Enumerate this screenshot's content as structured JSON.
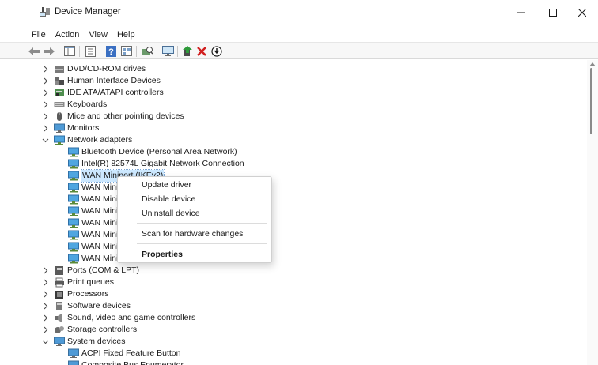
{
  "window": {
    "title": "Device Manager",
    "app_icon": "device-manager-icon",
    "controls": [
      "minimize-icon",
      "maximize-icon",
      "close-icon"
    ]
  },
  "menu": [
    "File",
    "Action",
    "View",
    "Help"
  ],
  "toolbar": {
    "buttons": [
      "back-arrow-icon",
      "forward-arrow-icon",
      "show-hide-console-tree-icon",
      "properties-sheet-icon",
      "help-icon",
      "view-icon",
      "scan-hardware-icon",
      "monitor-icon",
      "update-driver-icon",
      "uninstall-x-icon",
      "download-circle-icon"
    ]
  },
  "tree": {
    "rows": [
      {
        "label": "DVD/CD-ROM drives",
        "level": 0,
        "expanded": false,
        "icon": "dvd-drive-icon"
      },
      {
        "label": "Human Interface Devices",
        "level": 0,
        "expanded": false,
        "icon": "hid-icon"
      },
      {
        "label": "IDE ATA/ATAPI controllers",
        "level": 0,
        "expanded": false,
        "icon": "ide-controller-icon"
      },
      {
        "label": "Keyboards",
        "level": 0,
        "expanded": false,
        "icon": "keyboard-icon"
      },
      {
        "label": "Mice and other pointing devices",
        "level": 0,
        "expanded": false,
        "icon": "mouse-icon"
      },
      {
        "label": "Monitors",
        "level": 0,
        "expanded": false,
        "icon": "monitor-icon"
      },
      {
        "label": "Network adapters",
        "level": 0,
        "expanded": true,
        "icon": "network-adapter-icon"
      },
      {
        "label": "Bluetooth Device (Personal Area Network)",
        "level": 1,
        "icon": "network-adapter-icon"
      },
      {
        "label": "Intel(R) 82574L Gigabit Network Connection",
        "level": 1,
        "icon": "network-adapter-icon"
      },
      {
        "label": "WAN Miniport (IKEv2)",
        "level": 1,
        "icon": "network-adapter-icon",
        "selected": true
      },
      {
        "label": "WAN Mini",
        "level": 1,
        "icon": "network-adapter-icon"
      },
      {
        "label": "WAN Mini",
        "level": 1,
        "icon": "network-adapter-icon"
      },
      {
        "label": "WAN Mini",
        "level": 1,
        "icon": "network-adapter-icon"
      },
      {
        "label": "WAN Mini",
        "level": 1,
        "icon": "network-adapter-icon"
      },
      {
        "label": "WAN Mini",
        "level": 1,
        "icon": "network-adapter-icon"
      },
      {
        "label": "WAN Mini",
        "level": 1,
        "icon": "network-adapter-icon"
      },
      {
        "label": "WAN Mini",
        "level": 1,
        "icon": "network-adapter-icon"
      },
      {
        "label": "Ports (COM & LPT)",
        "level": 0,
        "expanded": false,
        "icon": "port-icon"
      },
      {
        "label": "Print queues",
        "level": 0,
        "expanded": false,
        "icon": "printer-icon"
      },
      {
        "label": "Processors",
        "level": 0,
        "expanded": false,
        "icon": "processor-icon"
      },
      {
        "label": "Software devices",
        "level": 0,
        "expanded": false,
        "icon": "software-device-icon"
      },
      {
        "label": "Sound, video and game controllers",
        "level": 0,
        "expanded": false,
        "icon": "sound-icon"
      },
      {
        "label": "Storage controllers",
        "level": 0,
        "expanded": false,
        "icon": "storage-controller-icon"
      },
      {
        "label": "System devices",
        "level": 0,
        "expanded": true,
        "icon": "system-device-icon"
      },
      {
        "label": "ACPI Fixed Feature Button",
        "level": 1,
        "icon": "system-device-icon"
      },
      {
        "label": "Composite Bus Enumerator",
        "level": 1,
        "icon": "system-device-icon"
      }
    ]
  },
  "context_menu": {
    "items": [
      {
        "label": "Update driver",
        "bold": false
      },
      {
        "label": "Disable device",
        "bold": false
      },
      {
        "label": "Uninstall device",
        "bold": false
      },
      {
        "label": "Scan for hardware changes",
        "bold": false
      },
      {
        "label": "Properties",
        "bold": true
      }
    ]
  },
  "colors": {
    "selection": "#cce8ff",
    "accent": "#0078d4"
  }
}
